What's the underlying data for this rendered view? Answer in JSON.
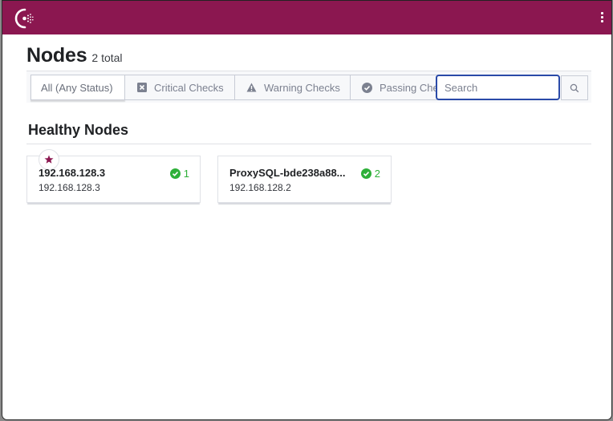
{
  "app": {
    "brand_color": "#8b1750",
    "logo_icon": "consul-logo",
    "menu_icon": "vertical-ellipsis"
  },
  "header": {
    "title": "Nodes",
    "count_label": "2 total"
  },
  "filters": {
    "tabs": [
      {
        "label": "All (Any Status)",
        "icon": null,
        "active": true
      },
      {
        "label": "Critical Checks",
        "icon": "critical-x-square",
        "active": false
      },
      {
        "label": "Warning Checks",
        "icon": "warning-triangle",
        "active": false
      },
      {
        "label": "Passing Checks",
        "icon": "check-circle",
        "active": false
      }
    ],
    "search": {
      "value": "",
      "placeholder": "Search",
      "focus_color": "#2a4aa8"
    }
  },
  "sections": [
    {
      "title": "Healthy Nodes",
      "nodes": [
        {
          "name": "192.168.128.3",
          "address": "192.168.128.3",
          "passing_count": "1",
          "leader": true
        },
        {
          "name": "ProxySQL-bde238a88...",
          "address": "192.168.128.2",
          "passing_count": "2",
          "leader": false
        }
      ]
    }
  ],
  "colors": {
    "passing": "#2eb039",
    "leader_star": "#8b1750"
  }
}
